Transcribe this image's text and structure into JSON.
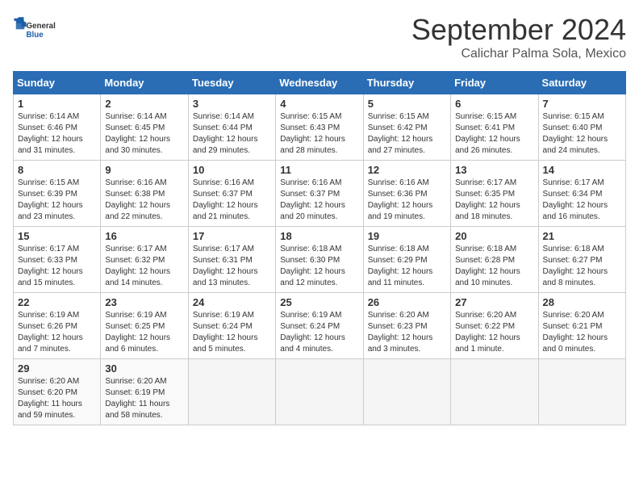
{
  "logo": {
    "line1": "General",
    "line2": "Blue"
  },
  "title": "September 2024",
  "location": "Calichar Palma Sola, Mexico",
  "headers": [
    "Sunday",
    "Monday",
    "Tuesday",
    "Wednesday",
    "Thursday",
    "Friday",
    "Saturday"
  ],
  "weeks": [
    [
      {
        "day": "1",
        "info": "Sunrise: 6:14 AM\nSunset: 6:46 PM\nDaylight: 12 hours\nand 31 minutes."
      },
      {
        "day": "2",
        "info": "Sunrise: 6:14 AM\nSunset: 6:45 PM\nDaylight: 12 hours\nand 30 minutes."
      },
      {
        "day": "3",
        "info": "Sunrise: 6:14 AM\nSunset: 6:44 PM\nDaylight: 12 hours\nand 29 minutes."
      },
      {
        "day": "4",
        "info": "Sunrise: 6:15 AM\nSunset: 6:43 PM\nDaylight: 12 hours\nand 28 minutes."
      },
      {
        "day": "5",
        "info": "Sunrise: 6:15 AM\nSunset: 6:42 PM\nDaylight: 12 hours\nand 27 minutes."
      },
      {
        "day": "6",
        "info": "Sunrise: 6:15 AM\nSunset: 6:41 PM\nDaylight: 12 hours\nand 26 minutes."
      },
      {
        "day": "7",
        "info": "Sunrise: 6:15 AM\nSunset: 6:40 PM\nDaylight: 12 hours\nand 24 minutes."
      }
    ],
    [
      {
        "day": "8",
        "info": "Sunrise: 6:15 AM\nSunset: 6:39 PM\nDaylight: 12 hours\nand 23 minutes."
      },
      {
        "day": "9",
        "info": "Sunrise: 6:16 AM\nSunset: 6:38 PM\nDaylight: 12 hours\nand 22 minutes."
      },
      {
        "day": "10",
        "info": "Sunrise: 6:16 AM\nSunset: 6:37 PM\nDaylight: 12 hours\nand 21 minutes."
      },
      {
        "day": "11",
        "info": "Sunrise: 6:16 AM\nSunset: 6:37 PM\nDaylight: 12 hours\nand 20 minutes."
      },
      {
        "day": "12",
        "info": "Sunrise: 6:16 AM\nSunset: 6:36 PM\nDaylight: 12 hours\nand 19 minutes."
      },
      {
        "day": "13",
        "info": "Sunrise: 6:17 AM\nSunset: 6:35 PM\nDaylight: 12 hours\nand 18 minutes."
      },
      {
        "day": "14",
        "info": "Sunrise: 6:17 AM\nSunset: 6:34 PM\nDaylight: 12 hours\nand 16 minutes."
      }
    ],
    [
      {
        "day": "15",
        "info": "Sunrise: 6:17 AM\nSunset: 6:33 PM\nDaylight: 12 hours\nand 15 minutes."
      },
      {
        "day": "16",
        "info": "Sunrise: 6:17 AM\nSunset: 6:32 PM\nDaylight: 12 hours\nand 14 minutes."
      },
      {
        "day": "17",
        "info": "Sunrise: 6:17 AM\nSunset: 6:31 PM\nDaylight: 12 hours\nand 13 minutes."
      },
      {
        "day": "18",
        "info": "Sunrise: 6:18 AM\nSunset: 6:30 PM\nDaylight: 12 hours\nand 12 minutes."
      },
      {
        "day": "19",
        "info": "Sunrise: 6:18 AM\nSunset: 6:29 PM\nDaylight: 12 hours\nand 11 minutes."
      },
      {
        "day": "20",
        "info": "Sunrise: 6:18 AM\nSunset: 6:28 PM\nDaylight: 12 hours\nand 10 minutes."
      },
      {
        "day": "21",
        "info": "Sunrise: 6:18 AM\nSunset: 6:27 PM\nDaylight: 12 hours\nand 8 minutes."
      }
    ],
    [
      {
        "day": "22",
        "info": "Sunrise: 6:19 AM\nSunset: 6:26 PM\nDaylight: 12 hours\nand 7 minutes."
      },
      {
        "day": "23",
        "info": "Sunrise: 6:19 AM\nSunset: 6:25 PM\nDaylight: 12 hours\nand 6 minutes."
      },
      {
        "day": "24",
        "info": "Sunrise: 6:19 AM\nSunset: 6:24 PM\nDaylight: 12 hours\nand 5 minutes."
      },
      {
        "day": "25",
        "info": "Sunrise: 6:19 AM\nSunset: 6:24 PM\nDaylight: 12 hours\nand 4 minutes."
      },
      {
        "day": "26",
        "info": "Sunrise: 6:20 AM\nSunset: 6:23 PM\nDaylight: 12 hours\nand 3 minutes."
      },
      {
        "day": "27",
        "info": "Sunrise: 6:20 AM\nSunset: 6:22 PM\nDaylight: 12 hours\nand 1 minute."
      },
      {
        "day": "28",
        "info": "Sunrise: 6:20 AM\nSunset: 6:21 PM\nDaylight: 12 hours\nand 0 minutes."
      }
    ],
    [
      {
        "day": "29",
        "info": "Sunrise: 6:20 AM\nSunset: 6:20 PM\nDaylight: 11 hours\nand 59 minutes."
      },
      {
        "day": "30",
        "info": "Sunrise: 6:20 AM\nSunset: 6:19 PM\nDaylight: 11 hours\nand 58 minutes."
      },
      {
        "day": "",
        "info": ""
      },
      {
        "day": "",
        "info": ""
      },
      {
        "day": "",
        "info": ""
      },
      {
        "day": "",
        "info": ""
      },
      {
        "day": "",
        "info": ""
      }
    ]
  ]
}
